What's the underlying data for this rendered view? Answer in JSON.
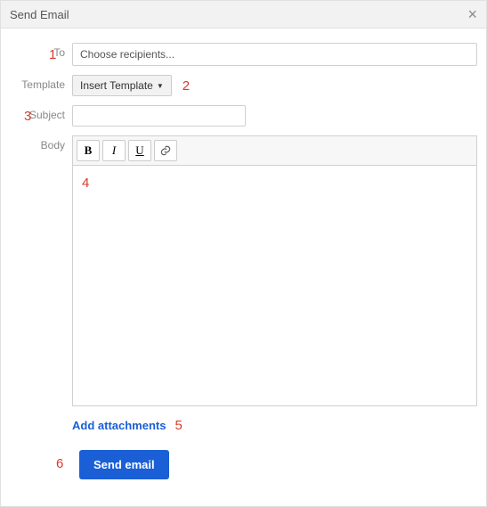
{
  "header": {
    "title": "Send Email"
  },
  "labels": {
    "to": "To",
    "template": "Template",
    "subject": "Subject",
    "body": "Body"
  },
  "to": {
    "placeholder": "Choose recipients..."
  },
  "template_btn": "Insert Template",
  "editor": {
    "bold": "B",
    "italic": "I",
    "underline": "U"
  },
  "add_attachments": "Add attachments",
  "send_button": "Send email",
  "annotations": {
    "a1": "1",
    "a2": "2",
    "a3": "3",
    "a4": "4",
    "a5": "5",
    "a6": "6"
  }
}
